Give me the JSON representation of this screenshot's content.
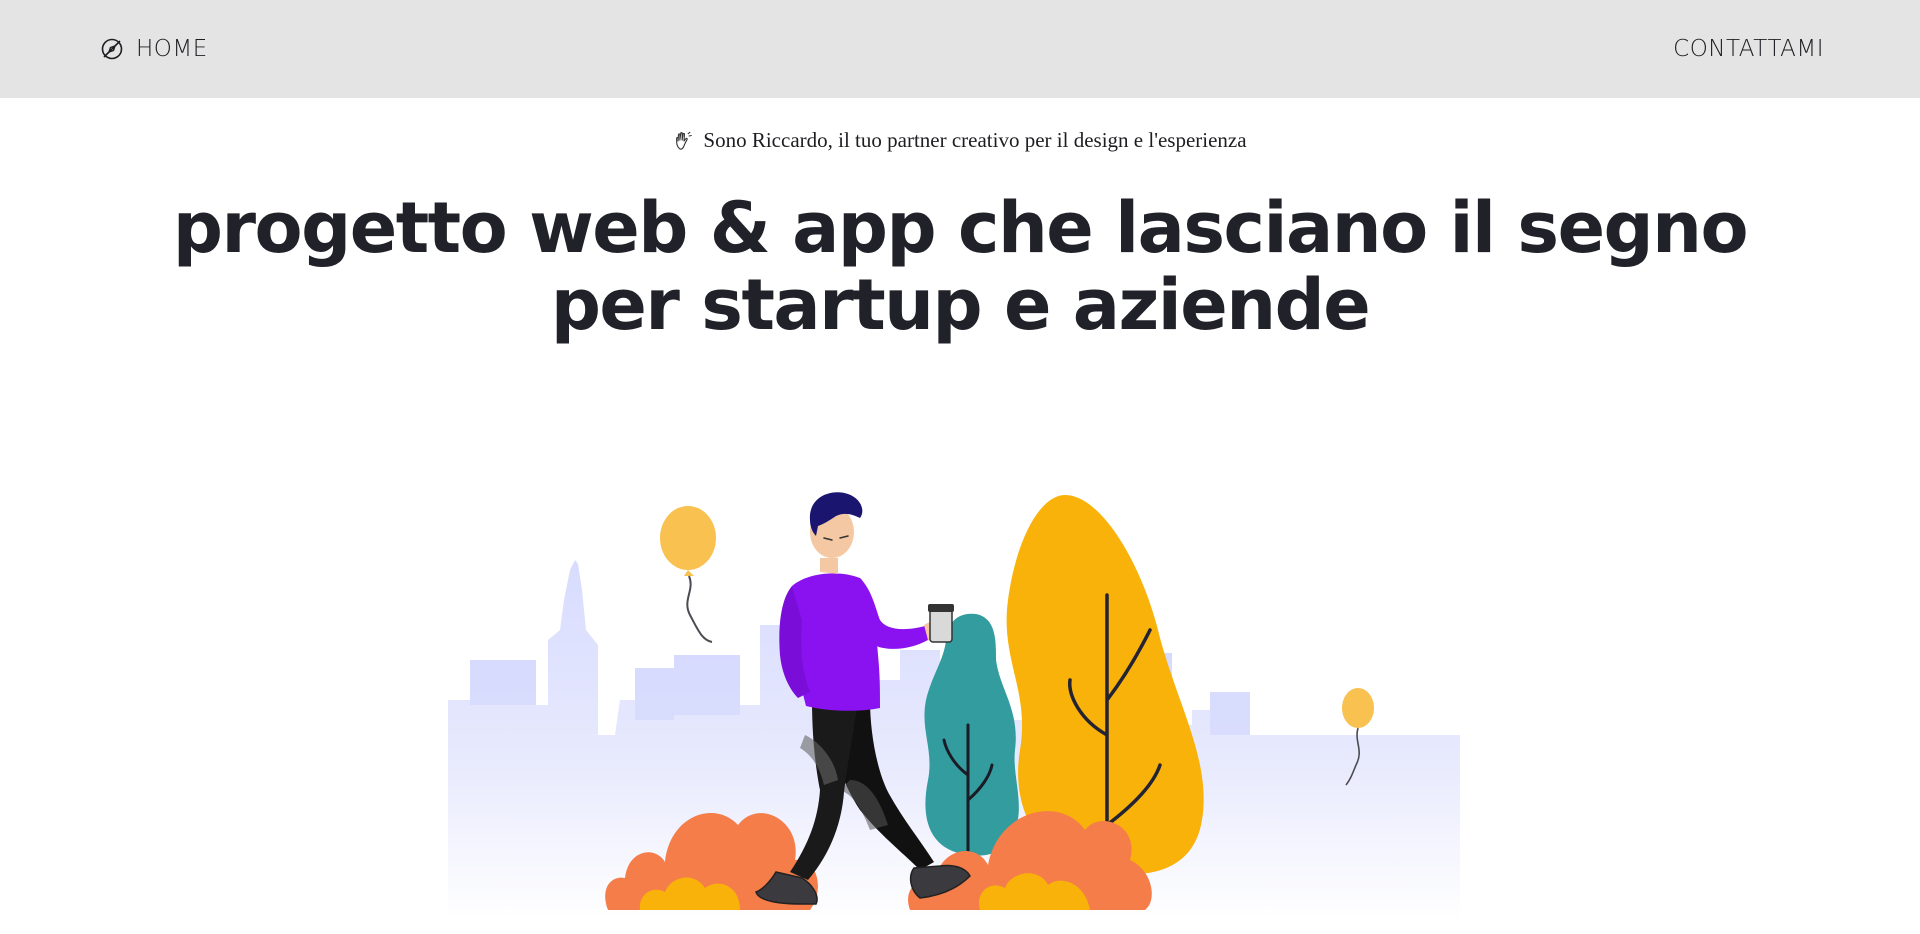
{
  "nav": {
    "home_label": "HOME",
    "home_icon": "compass-icon",
    "contact_label": "CONTATTAMI"
  },
  "hero": {
    "intro_icon": "waving-hand-icon",
    "intro_text": "Sono Riccardo, il tuo partner creativo per il design e l'esperienza",
    "headline": "progetto web & app che lasciano il segno per startup e aziende"
  },
  "illustration": {
    "description_icon": "man-walking-with-coffee-in-city-park-illustration"
  },
  "colors": {
    "navbar_bg": "#e4e4e4",
    "headline": "#212229",
    "sweater": "#8b12f0",
    "teal_tree": "#329c9e",
    "yellow_tree": "#f8b20a",
    "orange_bush": "#f47d4a",
    "balloon": "#f8c150",
    "skyline": "#d6dafe"
  }
}
